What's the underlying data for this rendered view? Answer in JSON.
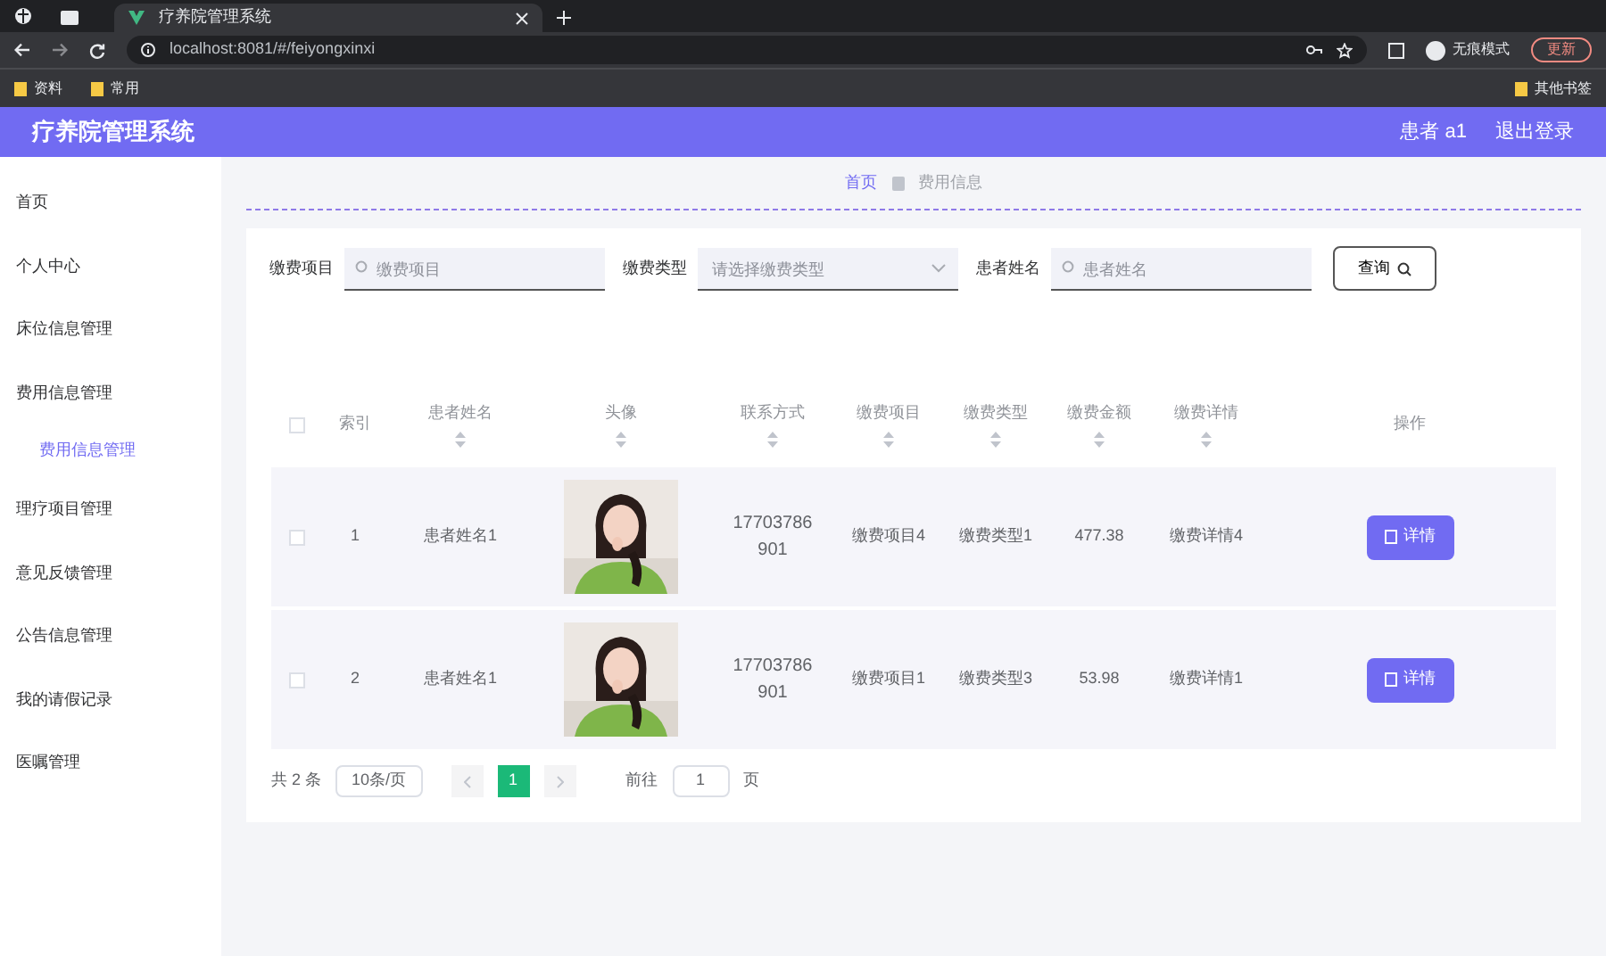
{
  "browser": {
    "tab_title": "疗养院管理系统",
    "url": "localhost:8081/#/feiyongxinxi",
    "profile": "无痕模式",
    "update_button": "更新",
    "bookmarks": [
      "资料",
      "常用"
    ],
    "other_bookmarks": "其他书签"
  },
  "app": {
    "title": "疗养院管理系统",
    "user": "患者 a1",
    "logout": "退出登录"
  },
  "sidebar": {
    "items": [
      {
        "label": "首页",
        "selected": false
      },
      {
        "label": "个人中心",
        "selected": false
      },
      {
        "label": "床位信息管理",
        "selected": false
      },
      {
        "label": "费用信息管理",
        "selected": false,
        "children": [
          {
            "label": "费用信息管理",
            "selected": true
          }
        ]
      },
      {
        "label": "理疗项目管理",
        "selected": false
      },
      {
        "label": "意见反馈管理",
        "selected": false
      },
      {
        "label": "公告信息管理",
        "selected": false
      },
      {
        "label": "我的请假记录",
        "selected": false
      },
      {
        "label": "医嘱管理",
        "selected": false
      }
    ]
  },
  "breadcrumb": [
    {
      "label": "首页",
      "selected": true
    },
    {
      "label": "费用信息",
      "selected": false
    }
  ],
  "search": {
    "fields": [
      {
        "label": "缴费项目",
        "kind": "input",
        "placeholder": "缴费项目"
      },
      {
        "label": "缴费类型",
        "kind": "select",
        "placeholder": "请选择缴费类型"
      },
      {
        "label": "患者姓名",
        "kind": "input",
        "placeholder": "患者姓名"
      }
    ],
    "button": "查询"
  },
  "table": {
    "select_all_checked": false,
    "columns": [
      {
        "label": "索引",
        "sortable": false
      },
      {
        "label": "患者姓名",
        "sortable": true
      },
      {
        "label": "头像",
        "sortable": true
      },
      {
        "label": "联系方式",
        "sortable": true
      },
      {
        "label": "缴费项目",
        "sortable": true
      },
      {
        "label": "缴费类型",
        "sortable": true
      },
      {
        "label": "缴费金额",
        "sortable": true
      },
      {
        "label": "缴费详情",
        "sortable": true
      },
      {
        "label": "操作",
        "sortable": false
      }
    ],
    "rows": [
      {
        "checked": false,
        "index": "1",
        "name": "患者姓名1",
        "phone": "17703786901",
        "item": "缴费项目4",
        "type": "缴费类型1",
        "amount": "477.38",
        "detail": "缴费详情4",
        "action": "详情"
      },
      {
        "checked": false,
        "index": "2",
        "name": "患者姓名1",
        "phone": "17703786901",
        "item": "缴费项目1",
        "type": "缴费类型3",
        "amount": "53.98",
        "detail": "缴费详情1",
        "action": "详情"
      }
    ]
  },
  "pagination": {
    "total": "共 2 条",
    "page_size": "10条/页",
    "pages": [
      {
        "label": "1",
        "selected": true
      }
    ],
    "goto_label": "前往",
    "goto_value": "1",
    "goto_suffix": "页"
  }
}
